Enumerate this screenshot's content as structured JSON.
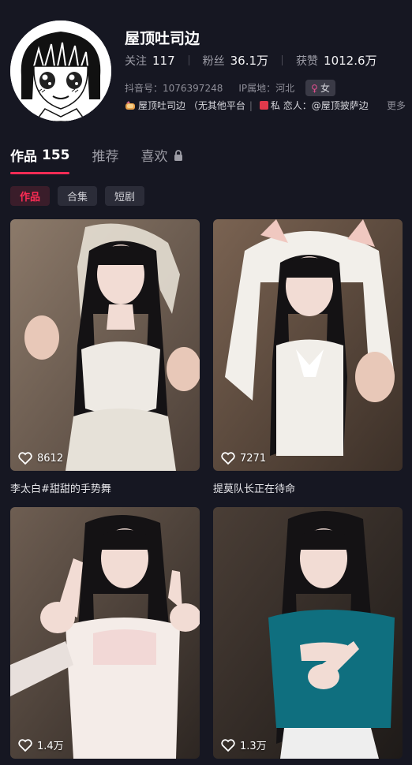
{
  "profile": {
    "name": "屋顶吐司边",
    "stats": [
      {
        "label": "关注",
        "value": "117"
      },
      {
        "label": "粉丝",
        "value": "36.1万"
      },
      {
        "label": "获赞",
        "value": "1012.6万"
      }
    ],
    "douyin_id": "抖音号：1076397248",
    "ip_location": "IP属地：河北",
    "gender": "女",
    "bio": {
      "part1": "屋顶吐司边 （无其他平台",
      "separator": "|",
      "part2": "私 恋人：@屋顶披萨边",
      "more": "更多"
    }
  },
  "tabs": [
    {
      "label": "作品",
      "count": "155",
      "active": true
    },
    {
      "label": "推荐"
    },
    {
      "label": "喜欢",
      "locked": true
    }
  ],
  "subtabs": [
    {
      "label": "作品",
      "active": true
    },
    {
      "label": "合集"
    },
    {
      "label": "短剧"
    }
  ],
  "videos": [
    {
      "likes": "8612",
      "caption": "李太白#甜甜的手势舞",
      "outfit_color": "#eeeae4"
    },
    {
      "likes": "7271",
      "caption": "提莫队长正在待命",
      "outfit_color": "#f1eee9"
    },
    {
      "likes": "1.4万",
      "caption": "",
      "outfit_color": "#f2d8d6"
    },
    {
      "likes": "1.3万",
      "caption": "",
      "outfit_color": "#0f6f7f"
    }
  ],
  "colors": {
    "background": "#161722",
    "accent": "#fe2c55"
  }
}
